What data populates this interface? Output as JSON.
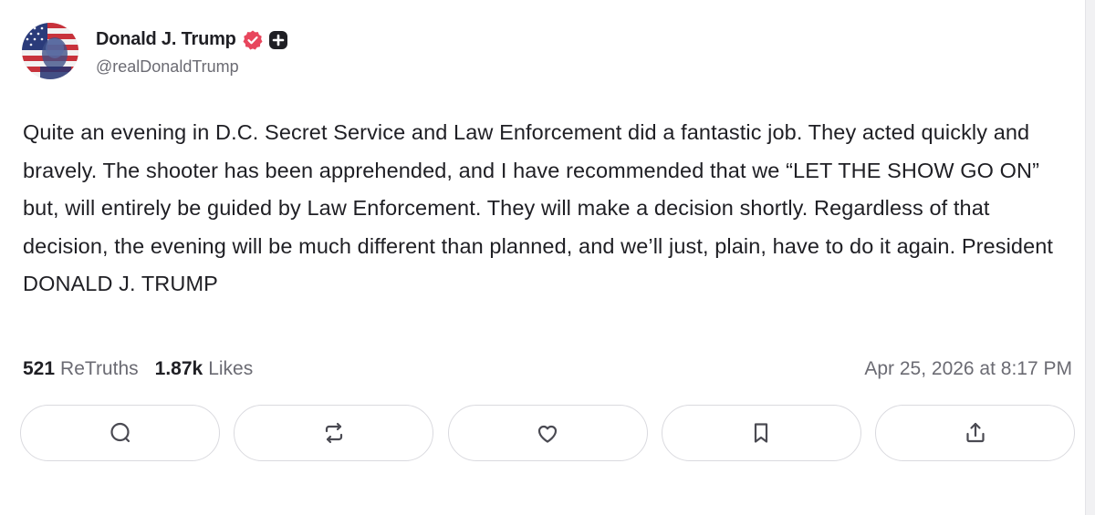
{
  "author": {
    "display_name": "Donald J. Trump",
    "handle": "@realDonaldTrump",
    "avatar_icon": "avatar-portrait",
    "verified_icon": "verified-badge-icon",
    "plus_icon": "plus-badge-icon",
    "verified_color": "#e8465d"
  },
  "post": {
    "text": "Quite an evening in D.C. Secret Service and Law Enforcement did a fantastic job. They acted quickly and bravely. The shooter has been apprehended, and I have recommended that we “LET THE SHOW GO ON” but, will entirely be guided by Law Enforcement. They will make a decision shortly. Regardless of that decision, the evening will be much different than planned, and we’ll just, plain, have to do it again. President DONALD J. TRUMP"
  },
  "stats": {
    "retruths_count": "521",
    "retruths_label": "ReTruths",
    "likes_count": "1.87k",
    "likes_label": "Likes"
  },
  "timestamp": "Apr 25, 2026 at 8:17 PM",
  "actions": [
    {
      "icon": "reply-icon"
    },
    {
      "icon": "retruth-icon"
    },
    {
      "icon": "like-icon"
    },
    {
      "icon": "bookmark-icon"
    },
    {
      "icon": "share-icon"
    }
  ],
  "colors": {
    "text": "#1f1f24",
    "muted": "#6b6b73",
    "border": "#dadadf",
    "icon": "#4a4a52"
  }
}
